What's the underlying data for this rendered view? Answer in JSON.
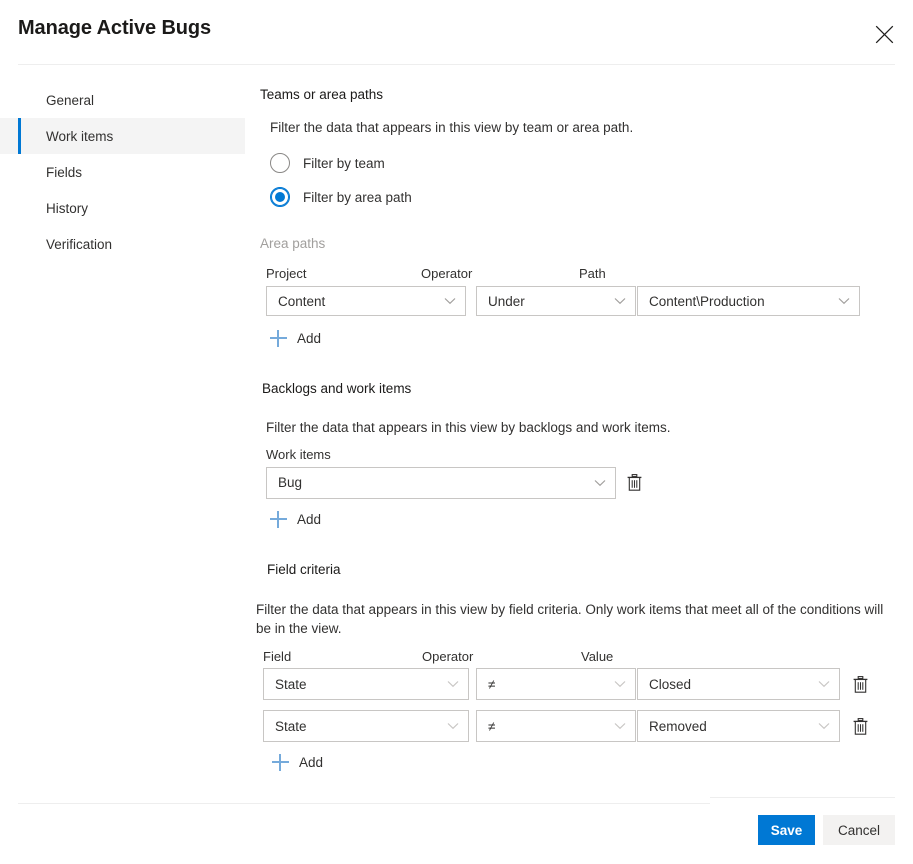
{
  "dialog": {
    "title": "Manage Active Bugs",
    "close_label": "Close"
  },
  "sidebar": {
    "items": [
      {
        "label": "General",
        "selected": false
      },
      {
        "label": "Work items",
        "selected": true
      },
      {
        "label": "Fields",
        "selected": false
      },
      {
        "label": "History",
        "selected": false
      },
      {
        "label": "Verification",
        "selected": false
      }
    ]
  },
  "teams_or_area_paths": {
    "title": "Teams or area paths",
    "description": "Filter the data that appears in this view by team or area path.",
    "radios": [
      {
        "label": "Filter by team",
        "checked": false
      },
      {
        "label": "Filter by area path",
        "checked": true
      }
    ],
    "area_paths_label": "Area paths",
    "columns": {
      "project": "Project",
      "operator": "Operator",
      "path": "Path"
    },
    "rows": [
      {
        "project": "Content",
        "operator": "Under",
        "path": "Content\\Production"
      }
    ],
    "add_label": "Add"
  },
  "backlogs_and_work_items": {
    "title": "Backlogs and work items",
    "description": "Filter the data that appears in this view by backlogs and work items.",
    "work_items_label": "Work items",
    "rows": [
      {
        "value": "Bug"
      }
    ],
    "add_label": "Add"
  },
  "field_criteria": {
    "title": "Field criteria",
    "description": "Filter the data that appears in this view by field criteria. Only work items that meet all of the conditions will be in the view.",
    "columns": {
      "field": "Field",
      "operator": "Operator",
      "value": "Value"
    },
    "rows": [
      {
        "field": "State",
        "operator": "≠",
        "value": "Closed"
      },
      {
        "field": "State",
        "operator": "≠",
        "value": "Removed"
      }
    ],
    "add_label": "Add"
  },
  "footer": {
    "save_label": "Save",
    "cancel_label": "Cancel"
  },
  "colors": {
    "accent": "#0078d4",
    "selection_bg": "#f4f4f4",
    "border": "#c8c6c4",
    "add_plus": "#75aadb",
    "secondary_button_bg": "#f3f2f1"
  }
}
